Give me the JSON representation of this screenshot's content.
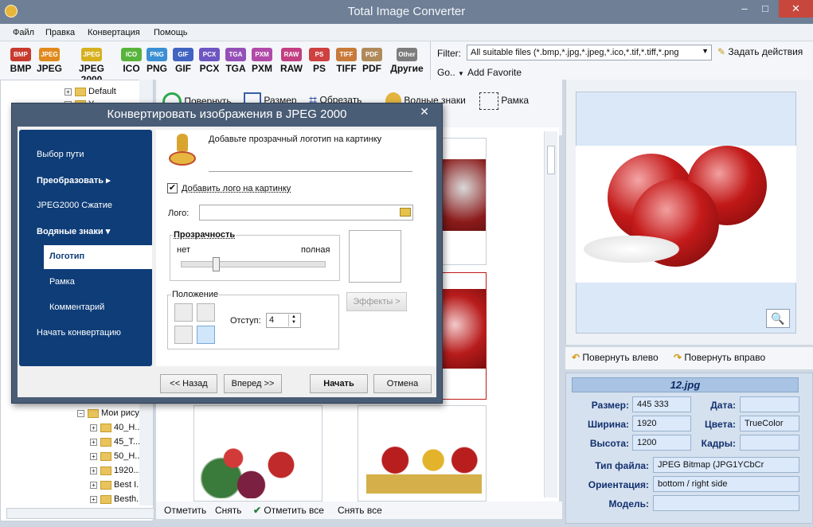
{
  "app": {
    "title": "Total Image Converter"
  },
  "window_buttons": {
    "minimize": "–",
    "maximize": "□",
    "close": "✕"
  },
  "menu": [
    "Файл",
    "Правка",
    "Конвертация",
    "Помощь"
  ],
  "formats": [
    {
      "icon": "BMP",
      "label": "BMP",
      "color": "#c83a2e"
    },
    {
      "icon": "JPEG",
      "label": "JPEG",
      "color": "#e08a1e"
    },
    {
      "icon": "JPEG 2000",
      "label": "JPEG 2000",
      "color": "#d6b01e"
    },
    {
      "icon": "ICO",
      "label": "ICO",
      "color": "#58b43c"
    },
    {
      "icon": "PNG",
      "label": "PNG",
      "color": "#3b8fd4"
    },
    {
      "icon": "GIF",
      "label": "GIF",
      "color": "#4164c2"
    },
    {
      "icon": "PCX",
      "label": "PCX",
      "color": "#6d56c2"
    },
    {
      "icon": "TGA",
      "label": "TGA",
      "color": "#9550b8"
    },
    {
      "icon": "PXM",
      "label": "PXM",
      "color": "#b14aa8"
    },
    {
      "icon": "RAW",
      "label": "RAW",
      "color": "#c23f82"
    },
    {
      "icon": "PS",
      "label": "PS",
      "color": "#cf4040"
    },
    {
      "icon": "TIFF",
      "label": "TIFF",
      "color": "#c87a3a"
    },
    {
      "icon": "PDF",
      "label": "PDF",
      "color": "#b08a5a"
    },
    {
      "icon": "Other",
      "label": "Другие",
      "color": "#7d7d7d"
    }
  ],
  "filter": {
    "label": "Filter:",
    "value": "All suitable files (*.bmp,*.jpg,*.jpeg,*.ico,*.tif,*.tiff,*.png",
    "actions": "Задать действия",
    "go": "Go..",
    "favorite": "Add Favorite"
  },
  "tree": {
    "top_items": [
      "Default",
      "Y..."
    ],
    "bottom_items": [
      "Мои рису...",
      "40_H...",
      "45_T...",
      "50_H...",
      "1920...",
      "Best I...",
      "Besth..."
    ]
  },
  "toolbar": {
    "rotate": "Повернуть",
    "resize": "Размер",
    "crop": "Обрезать",
    "watermark": "Водные знаки",
    "frame": "Рамка"
  },
  "bottom_bar": {
    "mark": "Отметить",
    "unmark": "Снять",
    "mark_all": "Отметить все",
    "unmark_all": "Снять все"
  },
  "preview": {
    "rotate_left": "Повернуть влево",
    "rotate_right": "Повернуть вправо"
  },
  "info": {
    "filename": "12.jpg",
    "size_label": "Размер:",
    "size": "445 333",
    "date_label": "Дата:",
    "date": "",
    "width_label": "Ширина:",
    "width": "1920",
    "colors_label": "Цвета:",
    "colors": "TrueColor",
    "height_label": "Высота:",
    "height": "1200",
    "frames_label": "Кадры:",
    "frames": "",
    "filetype_label": "Тип файла:",
    "filetype": "JPEG Bitmap (JPG1YCbCr",
    "orientation_label": "Ориентация:",
    "orientation": "bottom / right side",
    "model_label": "Модель:",
    "model": ""
  },
  "dialog": {
    "title": "Конвертировать изображения в JPEG 2000",
    "nav": {
      "path": "Выбор пути",
      "convert": "Преобразовать",
      "compress": "JPEG2000 Сжатие",
      "watermarks": "Водяные знаки",
      "logo": "Логотип",
      "frame": "Рамка",
      "comment": "Комментарий",
      "start": "Начать конвертацию"
    },
    "header": "Добавьте прозрачный логотип на картинку",
    "add_logo_checkbox": "Добавить лого на картинку",
    "add_logo_checked": true,
    "logo_label": "Лого:",
    "logo_value": "",
    "transparency": {
      "title": "Прозрачность",
      "min": "нет",
      "max": "полная",
      "value_fraction": 0.24
    },
    "position": {
      "title": "Положение",
      "selected_cell": 3
    },
    "offset_label": "Отступ:",
    "offset_value": "4",
    "effects_button": "Эффекты >",
    "buttons": {
      "back": "<< Назад",
      "next": "Вперед >>",
      "start": "Начать",
      "cancel": "Отмена"
    }
  }
}
